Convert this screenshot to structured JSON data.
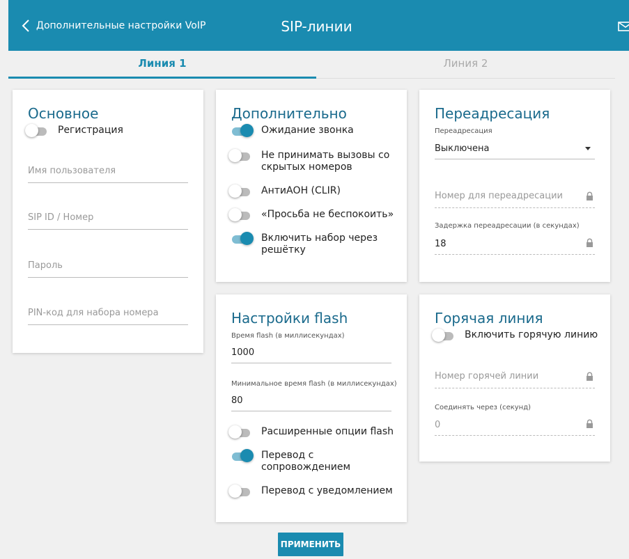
{
  "header": {
    "back_label": "Дополнительные настройки VoIP",
    "title": "SIP-линии",
    "bg_color": "#1a8bb0"
  },
  "tabs": [
    {
      "label": "Линия 1",
      "active": true
    },
    {
      "label": "Линия 2",
      "active": false
    }
  ],
  "basic": {
    "title": "Основное",
    "registration": {
      "label": "Регистрация",
      "on": false
    },
    "username": {
      "placeholder": "Имя пользователя",
      "value": ""
    },
    "sip_id": {
      "placeholder": "SIP ID / Номер",
      "value": ""
    },
    "password": {
      "placeholder": "Пароль",
      "value": ""
    },
    "pin": {
      "placeholder": "PIN-код для набора номера",
      "value": ""
    }
  },
  "additional": {
    "title": "Дополнительно",
    "toggles": [
      {
        "label": "Ожидание звонка",
        "on": true
      },
      {
        "label": "Не принимать вызовы со скрытых номеров",
        "on": false
      },
      {
        "label": "АнтиАОН (CLIR)",
        "on": false
      },
      {
        "label": "«Просьба не беспокоить»",
        "on": false
      },
      {
        "label": "Включить набор через решётку",
        "on": true
      }
    ]
  },
  "forwarding": {
    "title": "Переадресация",
    "select_label": "Переадресация",
    "select_value": "Выключена",
    "number_placeholder": "Номер для переадресации",
    "delay_label": "Задержка переадресации (в секундах)",
    "delay_value": "18"
  },
  "flash": {
    "title": "Настройки flash",
    "time_label": "Время flash (в миллисекундах)",
    "time_value": "1000",
    "min_time_label": "Минимальное время flash (в миллисекундах)",
    "min_time_value": "80",
    "toggles": [
      {
        "label": "Расширенные опции flash",
        "on": false
      },
      {
        "label": "Перевод с сопровождением",
        "on": true
      },
      {
        "label": "Перевод с уведомлением",
        "on": false
      }
    ]
  },
  "hotline": {
    "title": "Горячая линия",
    "enable": {
      "label": "Включить горячую линию",
      "on": false
    },
    "number_placeholder": "Номер горячей линии",
    "connect_label": "Соединять через (секунд)",
    "connect_value": "0"
  },
  "apply_label": "ПРИМЕНИТЬ"
}
